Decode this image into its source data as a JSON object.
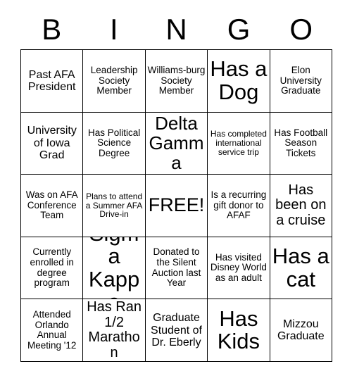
{
  "card": {
    "title_letters": [
      "B",
      "I",
      "N",
      "G",
      "O"
    ],
    "rows": [
      [
        {
          "text": "Past AFA President",
          "size": "md"
        },
        {
          "text": "Leadership Society Member",
          "size": "sm"
        },
        {
          "text": "Williams-burg Society Member",
          "size": "sm"
        },
        {
          "text": "Has a Dog",
          "size": "xxl"
        },
        {
          "text": "Elon University Graduate",
          "size": "sm"
        }
      ],
      [
        {
          "text": "University of Iowa Grad",
          "size": "md"
        },
        {
          "text": "Has Political Science Degree",
          "size": "sm"
        },
        {
          "text": "Delta Gamma",
          "size": "xl"
        },
        {
          "text": "Has completed international service trip",
          "size": "xs"
        },
        {
          "text": "Has Football Season Tickets",
          "size": "sm"
        }
      ],
      [
        {
          "text": "Was on AFA Conference Team",
          "size": "sm"
        },
        {
          "text": "Plans to attend a Summer AFA Drive-in",
          "size": "xs"
        },
        {
          "text": "FREE!",
          "size": "free"
        },
        {
          "text": "Is a recurring gift donor to AFAF",
          "size": "sm"
        },
        {
          "text": "Has been on a cruise",
          "size": "lg"
        }
      ],
      [
        {
          "text": "Currently enrolled in degree program",
          "size": "sm"
        },
        {
          "text": "Sigma Kappa",
          "size": "xxl"
        },
        {
          "text": "Donated to the Silent Auction last Year",
          "size": "sm"
        },
        {
          "text": "Has visited Disney World as an adult",
          "size": "sm"
        },
        {
          "text": "Has a cat",
          "size": "xxl"
        }
      ],
      [
        {
          "text": "Attended Orlando Annual Meeting '12",
          "size": "sm"
        },
        {
          "text": "Has Ran 1/2 Marathon",
          "size": "lg"
        },
        {
          "text": "Graduate Student of Dr. Eberly",
          "size": "md"
        },
        {
          "text": "Has Kids",
          "size": "xxl"
        },
        {
          "text": "Mizzou Graduate",
          "size": "md"
        }
      ]
    ]
  }
}
